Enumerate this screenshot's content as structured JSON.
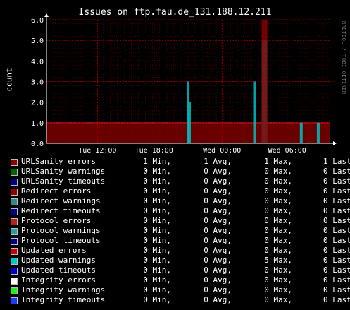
{
  "title": "Issues on ftp.fau.de_131.188.12.211",
  "ylabel": "count",
  "side_text": "RRDTOOL / TOBI OETIKER",
  "chart_data": {
    "type": "area",
    "ylim": [
      0,
      6
    ],
    "yticks": [
      "0.0",
      "1.0",
      "2.0",
      "3.0",
      "4.0",
      "5.0",
      "6.0"
    ],
    "xticks": [
      {
        "label": "Tue 12:00",
        "t": 0.18
      },
      {
        "label": "Tue 18:00",
        "t": 0.38
      },
      {
        "label": "Wed 00:00",
        "t": 0.62
      },
      {
        "label": "Wed 06:00",
        "t": 0.85
      }
    ],
    "grid": true,
    "series": [
      {
        "name": "URLSanity errors",
        "color": "#8b0000",
        "values": [
          {
            "t": 0.0,
            "v": 1
          },
          {
            "t": 1.0,
            "v": 1
          }
        ]
      },
      {
        "name": "Updated warnings",
        "color": "#00c0c0",
        "values": [
          {
            "t": 0.5,
            "v": 3
          },
          {
            "t": 0.505,
            "v": 2
          },
          {
            "t": 0.735,
            "v": 3
          },
          {
            "t": 0.765,
            "v": 5
          },
          {
            "t": 0.775,
            "v": 5
          },
          {
            "t": 0.9,
            "v": 1
          },
          {
            "t": 0.96,
            "v": 1
          }
        ]
      },
      {
        "name": "Updated errors",
        "color": "#8b0000",
        "values": [
          {
            "t": 0.765,
            "v": 6
          },
          {
            "t": 0.775,
            "v": 6
          }
        ]
      }
    ]
  },
  "legend": [
    {
      "name": "URLSanity errors",
      "color": "#8b0000",
      "min": "1 Min,",
      "avg": "1 Avg,",
      "max": "1 Max,",
      "last": "1 Last"
    },
    {
      "name": "URLSanity warnings",
      "color": "#006400",
      "min": "0 Min,",
      "avg": "0 Avg,",
      "max": "0 Max,",
      "last": "0 Last"
    },
    {
      "name": "URLSanity timeouts",
      "color": "#00008b",
      "min": "0 Min,",
      "avg": "0 Avg,",
      "max": "0 Max,",
      "last": "0 Last"
    },
    {
      "name": "Redirect errors",
      "color": "#8b0000",
      "min": "0 Min,",
      "avg": "0 Avg,",
      "max": "0 Max,",
      "last": "0 Last"
    },
    {
      "name": "Redirect warnings",
      "color": "#2e8b8b",
      "min": "0 Min,",
      "avg": "0 Avg,",
      "max": "0 Max,",
      "last": "0 Last"
    },
    {
      "name": "Redirect timeouts",
      "color": "#00008b",
      "min": "0 Min,",
      "avg": "0 Avg,",
      "max": "0 Max,",
      "last": "0 Last"
    },
    {
      "name": "Protocol errors",
      "color": "#b22222",
      "min": "0 Min,",
      "avg": "0 Avg,",
      "max": "0 Max,",
      "last": "0 Last"
    },
    {
      "name": "Protocol warnings",
      "color": "#20a0a0",
      "min": "0 Min,",
      "avg": "0 Avg,",
      "max": "0 Max,",
      "last": "0 Last"
    },
    {
      "name": "Protocol timeouts",
      "color": "#00008b",
      "min": "0 Min,",
      "avg": "0 Avg,",
      "max": "0 Max,",
      "last": "0 Last"
    },
    {
      "name": "Updated errors",
      "color": "#cc0000",
      "min": "0 Min,",
      "avg": "0 Avg,",
      "max": "0 Max,",
      "last": "0 Last"
    },
    {
      "name": "Updated warnings",
      "color": "#00c8c8",
      "min": "0 Min,",
      "avg": "0 Avg,",
      "max": "5 Max,",
      "last": "0 Last"
    },
    {
      "name": "Updated timeouts",
      "color": "#0000cc",
      "min": "0 Min,",
      "avg": "0 Avg,",
      "max": "0 Max,",
      "last": "0 Last"
    },
    {
      "name": "Integrity errors",
      "color": "#ffffff",
      "min": "0 Min,",
      "avg": "0 Avg,",
      "max": "0 Max,",
      "last": "0 Last"
    },
    {
      "name": "Integrity warnings",
      "color": "#22ee22",
      "min": "0 Min,",
      "avg": "0 Avg,",
      "max": "0 Max,",
      "last": "0 Last"
    },
    {
      "name": "Integrity timeouts",
      "color": "#1a3cff",
      "min": "0 Min,",
      "avg": "0 Avg,",
      "max": "0 Max,",
      "last": "0 Last"
    }
  ]
}
